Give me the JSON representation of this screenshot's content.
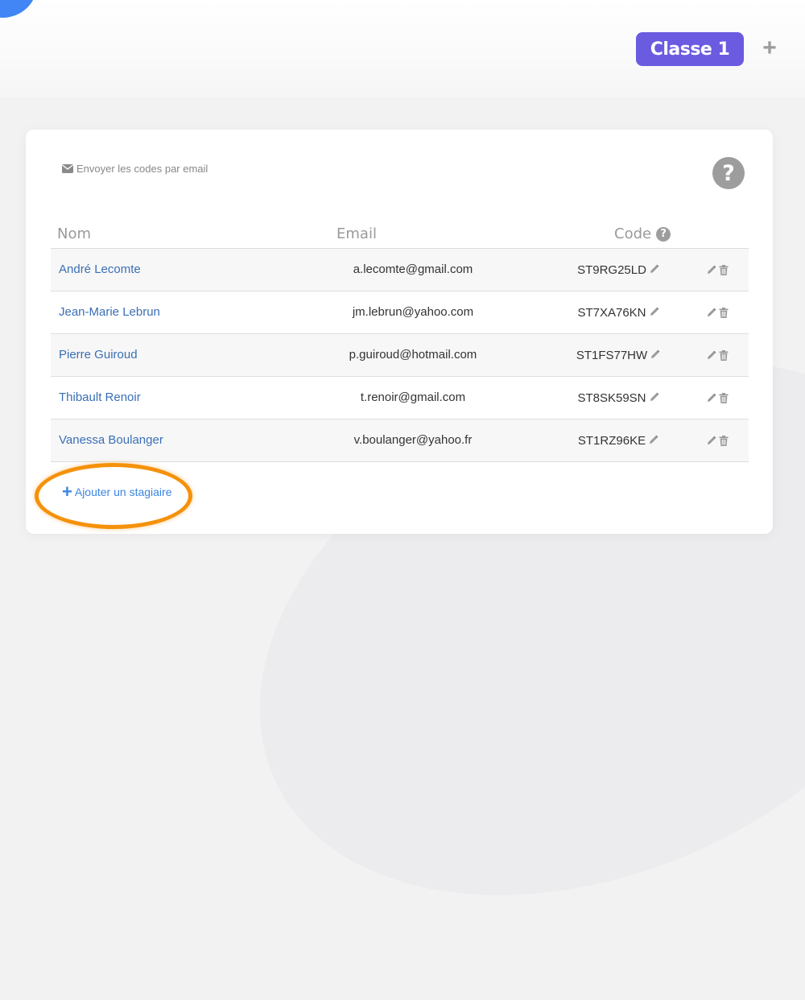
{
  "header": {
    "class_name": "Classe 1",
    "add_class_symbol": "+"
  },
  "card": {
    "send_codes_label": "Envoyer les codes par email",
    "help_symbol": "?",
    "add_trainee_label": "Ajouter un stagiaire"
  },
  "table": {
    "headers": {
      "name": "Nom",
      "email": "Email",
      "code": "Code"
    },
    "rows": [
      {
        "name": "André Lecomte",
        "email": "a.lecomte@gmail.com",
        "code": "ST9RG25LD"
      },
      {
        "name": "Jean-Marie Lebrun",
        "email": "jm.lebrun@yahoo.com",
        "code": "ST7XA76KN"
      },
      {
        "name": "Pierre Guiroud",
        "email": "p.guiroud@hotmail.com",
        "code": "ST1FS77HW"
      },
      {
        "name": "Thibault Renoir",
        "email": "t.renoir@gmail.com",
        "code": "ST8SK59SN"
      },
      {
        "name": "Vanessa Boulanger",
        "email": "v.boulanger@yahoo.fr",
        "code": "ST1RZ96KE"
      }
    ]
  },
  "icons": {
    "envelope": "envelope-icon",
    "help": "question-circle-icon",
    "edit": "pencil-icon",
    "delete": "trash-icon",
    "add": "plus-icon"
  },
  "colors": {
    "class_pill": "#6a5be0",
    "link": "#3a6fb5",
    "add_link": "#3a86e0",
    "highlight": "#f5910a",
    "corner_blob": "#4285f4"
  }
}
